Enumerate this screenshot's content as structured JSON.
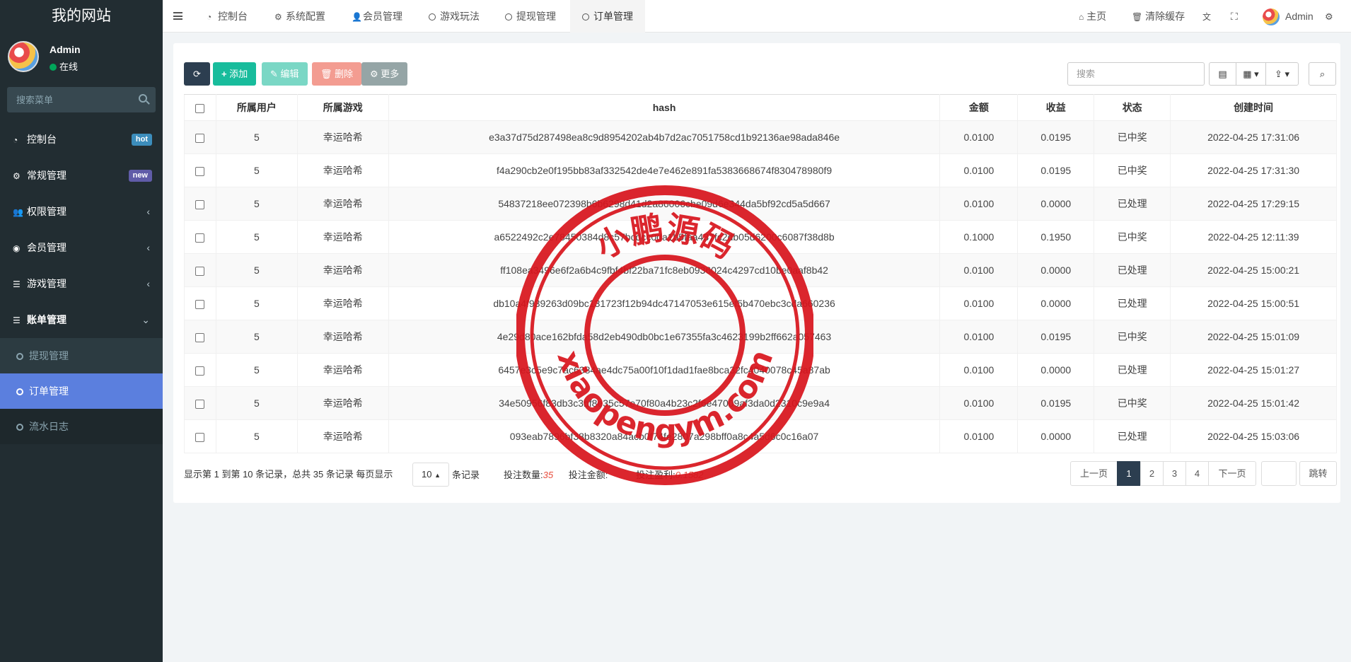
{
  "site": {
    "title": "我的网站"
  },
  "user": {
    "name": "Admin",
    "status": "在线"
  },
  "sidebar_search": {
    "placeholder": "搜索菜单"
  },
  "menu": [
    {
      "label": "控制台",
      "icon": "dashboard-icon",
      "badge": "hot"
    },
    {
      "label": "常规管理",
      "icon": "cogs-icon",
      "badge": "new"
    },
    {
      "label": "权限管理",
      "icon": "group-icon"
    },
    {
      "label": "会员管理",
      "icon": "user-circle-icon"
    },
    {
      "label": "游戏管理",
      "icon": "list-icon"
    },
    {
      "label": "账单管理",
      "icon": "list-icon",
      "expanded": true
    }
  ],
  "submenu": [
    {
      "label": "提现管理"
    },
    {
      "label": "订单管理",
      "active": true
    },
    {
      "label": "流水日志"
    }
  ],
  "tabs": [
    {
      "label": "控制台"
    },
    {
      "label": "系统配置"
    },
    {
      "label": "会员管理"
    },
    {
      "label": "游戏玩法"
    },
    {
      "label": "提现管理"
    },
    {
      "label": "订单管理",
      "active": true
    }
  ],
  "topright": {
    "home": "主页",
    "clear_cache": "清除缓存",
    "admin": "Admin"
  },
  "toolbar": {
    "add": "添加",
    "edit": "编辑",
    "delete": "删除",
    "more": "更多",
    "search_placeholder": "搜索"
  },
  "table": {
    "headers": [
      "所属用户",
      "所属游戏",
      "hash",
      "金额",
      "收益",
      "状态",
      "创建时间"
    ],
    "rows": [
      [
        "5",
        "幸运哈希",
        "e3a37d75d287498ea8c9d8954202ab4b7d2ac7051758cd1b92136ae98ada846e",
        "0.0100",
        "0.0195",
        "已中奖",
        "2022-04-25 17:31:06"
      ],
      [
        "5",
        "幸运哈希",
        "f4a290cb2e0f195bb83af332542de4e7e462e891fa5383668674f830478980f9",
        "0.0100",
        "0.0195",
        "已中奖",
        "2022-04-25 17:31:30"
      ],
      [
        "5",
        "幸运哈希",
        "54837218ee072398b6b6298d41d2a86006cbe09d6e344da5bf92cd5a5d667",
        "0.0100",
        "0.0000",
        "已处理",
        "2022-04-25 17:29:15"
      ],
      [
        "5",
        "幸运哈希",
        "a6522492c2e78450384d8c57bcdcc0da1b5faa437fc2db05d6200c6087f38d8b",
        "0.1000",
        "0.1950",
        "已中奖",
        "2022-04-25 12:11:39"
      ],
      [
        "5",
        "幸运哈希",
        "ff108ea3496e6f2a6b4c9fbf4bf22ba71fc8eb0936024c4297cd10be0aaf8b42",
        "0.0100",
        "0.0000",
        "已处理",
        "2022-04-25 15:00:21"
      ],
      [
        "5",
        "幸运哈希",
        "db10a4f939263d09bc131723f12b94dc47147053e615ef5b470ebc3cda660236",
        "0.0100",
        "0.0000",
        "已处理",
        "2022-04-25 15:00:51"
      ],
      [
        "5",
        "幸运哈希",
        "4e29d80ace162bfda58d2eb490db0bc1e67355fa3c4623199b2ff662a057463",
        "0.0100",
        "0.0195",
        "已中奖",
        "2022-04-25 15:01:09"
      ],
      [
        "5",
        "幸运哈希",
        "6457e3c5e9c7ac6384ae4dc75a00f10f1dad1fae8bca32fc4040078c45a87ab",
        "0.0100",
        "0.0000",
        "已处理",
        "2022-04-25 15:01:27"
      ],
      [
        "5",
        "幸运哈希",
        "34e50956f83db3c3bf8e35c57e70f80a4b23c2f6e47009af3da0d2310c9e9a4",
        "0.0100",
        "0.0195",
        "已中奖",
        "2022-04-25 15:01:42"
      ],
      [
        "5",
        "幸运哈希",
        "093eab7896bf38b8320a84acb0f74fe2807a298bff0a8c4a5d6c0c16a07",
        "0.0100",
        "0.0000",
        "已处理",
        "2022-04-25 15:03:06"
      ]
    ]
  },
  "pagination": {
    "info": "显示第 1 到第 10 条记录，总共 35 条记录 每页显示",
    "page_size": "10",
    "suffix": "条记录",
    "prev": "上一页",
    "next": "下一页",
    "pages": [
      "1",
      "2",
      "3",
      "4"
    ],
    "current": "1",
    "jump": "跳转"
  },
  "stats": {
    "count_label": "投注数量:",
    "count": "35",
    "amount_label": "投注金额:",
    "amount": "",
    "profit_label": "投注盈利:",
    "profit": "0.1582"
  },
  "watermark": {
    "top": "小鹏源码",
    "bottom": "xiaopengym.com"
  },
  "colors": {
    "sidebar": "#222d32",
    "primary": "#18bc9c",
    "dark": "#2c3e50",
    "win": "#e74c3c",
    "done": "#18bc9c",
    "stamp": "#d8141c"
  }
}
